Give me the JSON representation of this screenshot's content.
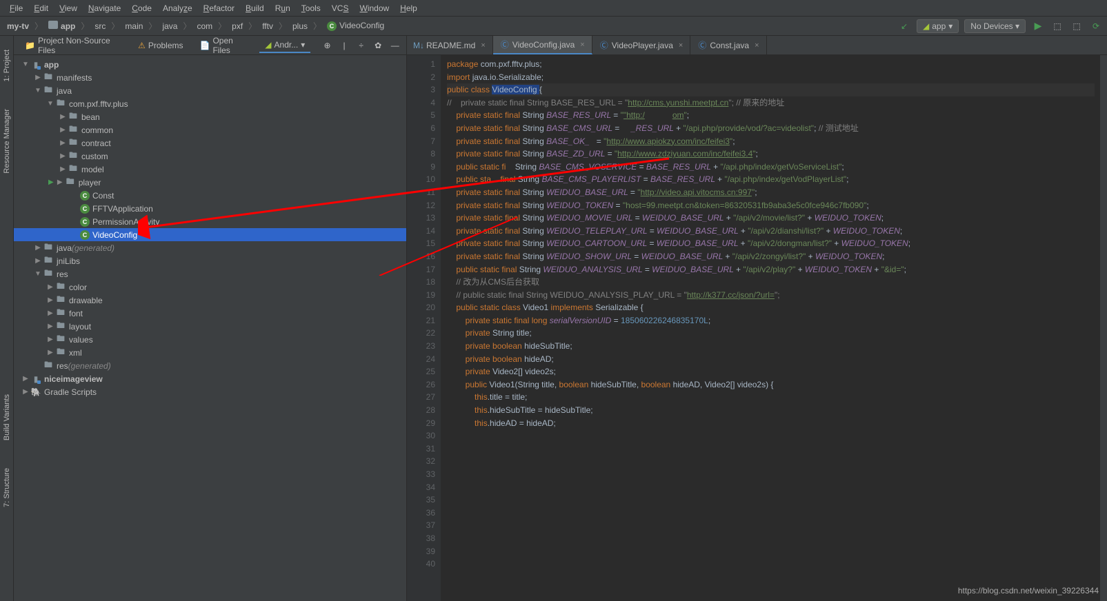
{
  "menu": {
    "file": "File",
    "edit": "Edit",
    "view": "View",
    "navigate": "Navigate",
    "code": "Code",
    "analyze": "Analyze",
    "refactor": "Refactor",
    "build": "Build",
    "run": "Run",
    "tools": "Tools",
    "vcs": "VCS",
    "window": "Window",
    "help": "Help"
  },
  "breadcrumb": [
    "my-tv",
    "app",
    "src",
    "main",
    "java",
    "com",
    "pxf",
    "fftv",
    "plus",
    "VideoConfig"
  ],
  "nav_right": {
    "run_config": "app",
    "devices": "No Devices ▾"
  },
  "panel_tabs": {
    "nsf": "Project Non-Source Files",
    "problems": "Problems",
    "open_files": "Open Files",
    "android": "Andr..."
  },
  "left_tabs": {
    "project": "1: Project",
    "rm": "Resource Manager",
    "bv": "Build Variants",
    "struct": "7: Structure"
  },
  "tree": {
    "app": "app",
    "manifests": "manifests",
    "java": "java",
    "pkg": "com.pxf.fftv.plus",
    "bean": "bean",
    "common": "common",
    "contract": "contract",
    "custom": "custom",
    "model": "model",
    "player": "player",
    "const": "Const",
    "fftvapp": "FFTVApplication",
    "permact": "PermissionActivity",
    "videoconfig": "VideoConfig",
    "javagen": "java",
    "gen": " (generated)",
    "jnilibs": "jniLibs",
    "res": "res",
    "color": "color",
    "drawable": "drawable",
    "font": "font",
    "layout": "layout",
    "values": "values",
    "xml": "xml",
    "resgen": "res",
    "niceimageview": "niceimageview",
    "gradle": "Gradle Scripts"
  },
  "editor_tabs": [
    {
      "name": "README.md",
      "icon": "md",
      "active": false
    },
    {
      "name": "VideoConfig.java",
      "icon": "java",
      "active": true
    },
    {
      "name": "VideoPlayer.java",
      "icon": "java",
      "active": false
    },
    {
      "name": "Const.java",
      "icon": "java",
      "active": false
    }
  ],
  "code": {
    "lines": [
      1,
      2,
      3,
      4,
      5,
      6,
      7,
      8,
      9,
      10,
      11,
      12,
      13,
      14,
      15,
      16,
      17,
      18,
      19,
      20,
      21,
      22,
      23,
      24,
      25,
      26,
      27,
      28,
      29,
      30,
      31,
      32,
      33,
      34,
      35,
      36,
      37,
      38,
      39,
      40
    ],
    "l1_a": "package ",
    "l1_b": "com.pxf.fftv.plus;",
    "l3_a": "import ",
    "l3_b": "java.io.Serializable;",
    "l5_a": "public class ",
    "l5_b": "VideoConfig ",
    "l5_c": "{",
    "l6": "//    private static final String BASE_RES_URL = \"",
    "l6b": "http://cms.yunshi.meetpt.cn",
    "l6c": "\"; // 原来的地址",
    "l7_a": "private static final ",
    "l7_b": "String ",
    "l7_c": "BASE_RES_URL ",
    "l7_d": "= ",
    "l7_e": "\"http:/",
    "l7_f": "om\"",
    "l7_g": ";",
    "l9_a": "private static final ",
    "l9_b": "String ",
    "l9_c": "BASE_CMS_URL ",
    "l9_d": "= ",
    "l9_e": "_RES_URL ",
    "l9_f": "+ ",
    "l9_g": "\"/api.php/provide/vod/?ac=videolist\"",
    "l9_h": "; ",
    "l9_i": "// 测试地址",
    "l10_a": "private static final ",
    "l10_b": "String ",
    "l10_c": "BASE_OK_",
    "l10_d": "= ",
    "l10_e": "\"http://www.apiokzy.com/inc/feifei3\"",
    "l10_f": ";",
    "l11_a": "private static final ",
    "l11_b": "String ",
    "l11_c": "BASE_ZD_URL ",
    "l11_d": "= ",
    "l11_e": "\"http://www.zdziyuan.com/inc/feifei3.4\"",
    "l11_f": ";",
    "l13_a": "public static fi",
    "l13_b": " String ",
    "l13_c": "BASE_CMS_VOSERVICE ",
    "l13_d": "= ",
    "l13_e": "BASE_RES_URL ",
    "l13_f": "+ ",
    "l13_g": "\"/api.php/index/getVoServiceList\"",
    "l13_h": ";",
    "l14_a": "public sta",
    "l14_b": " final ",
    "l14_b2": "String ",
    "l14_c": "BASE_CMS_PLAYERLIST ",
    "l14_d": "= ",
    "l14_e": "BASE_RES_URL ",
    "l14_f": "+ ",
    "l14_g": "\"/api.php/index/getVodPlayerList\"",
    "l14_h": ";",
    "l15_a": "private",
    "l15_b": " static final ",
    "l15_b2": "String ",
    "l15_c": "WEIDUO_BASE_URL ",
    "l15_d": "= ",
    "l15_e": "\"http://video.api.vitocms.cn:997\"",
    "l15_f": ";",
    "l16_a": "private static final ",
    "l16_b": "String ",
    "l16_c": "WEIDUO_TOKEN ",
    "l16_d": "= ",
    "l16_e": "\"host=99.meetpt.cn&token=86320531fb9aba3e5c0fce946c7fb090\"",
    "l16_f": ";",
    "l17_a": "private static final ",
    "l17_b": "String ",
    "l17_c": "WEIDUO_MOVIE_URL ",
    "l17_d": "= ",
    "l17_e": "WEIDUO_BASE_URL ",
    "l17_f": "+ ",
    "l17_g": "\"/api/v2/movie/list?\" ",
    "l17_h": "+ ",
    "l17_i": "WEIDUO_TOKEN",
    "l17_j": ";",
    "l18_a": "private static final ",
    "l18_b": "String ",
    "l18_c": "WEIDUO_TELEPLAY_URL ",
    "l18_d": "= ",
    "l18_e": "WEIDUO_BASE_URL ",
    "l18_f": "+ ",
    "l18_g": "\"/api/v2/dianshi/list?\" ",
    "l18_h": "+ ",
    "l18_i": "WEIDUO_TOKEN",
    "l18_j": ";",
    "l19_a": "private static final ",
    "l19_b": "String ",
    "l19_c": "WEIDUO_CARTOON_URL ",
    "l19_d": "= ",
    "l19_e": "WEIDUO_BASE_URL ",
    "l19_f": "+ ",
    "l19_g": "\"/api/v2/dongman/list?\" ",
    "l19_h": "+ ",
    "l19_i": "WEIDUO_TOKEN",
    "l19_j": ";",
    "l20_a": "private static final ",
    "l20_b": "String ",
    "l20_c": "WEIDUO_SHOW_URL ",
    "l20_d": "= ",
    "l20_e": "WEIDUO_BASE_URL ",
    "l20_f": "+ ",
    "l20_g": "\"/api/v2/zongyi/list?\" ",
    "l20_h": "+ ",
    "l20_i": "WEIDUO_TOKEN",
    "l20_j": ";",
    "l21_a": "public static final ",
    "l21_b": "String ",
    "l21_c": "WEIDUO_ANALYSIS_URL ",
    "l21_d": "= ",
    "l21_e": "WEIDUO_BASE_URL ",
    "l21_f": "+ ",
    "l21_g": "\"/api/v2/play?\" ",
    "l21_h": "+ ",
    "l21_i": "WEIDUO_TOKEN ",
    "l21_j": "+ ",
    "l21_k": "\"&id=\"",
    "l21_l": ";",
    "l22": "// 改为从CMS后台获取",
    "l23": "// public static final String WEIDUO_ANALYSIS_PLAY_URL = \"",
    "l23b": "http://k377.cc/json/?url=",
    "l23c": "\";",
    "l25_a": "public static class ",
    "l25_b": "Video1 ",
    "l25_c": "implements ",
    "l25_d": "Serializable ",
    "l25_e": "{",
    "l27_a": "private static final long ",
    "l27_b": "serialVersionUID ",
    "l27_c": "= ",
    "l27_d": "185060226246835170L",
    "l27_e": ";",
    "l29_a": "private ",
    "l29_b": "String ",
    "l29_c": "title;",
    "l31_a": "private boolean ",
    "l31_b": "hideSubTitle;",
    "l33_a": "private boolean ",
    "l33_b": "hideAD;",
    "l35_a": "private ",
    "l35_b": "Video2[] ",
    "l35_c": "video2s;",
    "l37_a": "public ",
    "l37_b": "Video1",
    "l37_c": "(String title, ",
    "l37_d": "boolean ",
    "l37_e": "hideSubTitle, ",
    "l37_f": "boolean ",
    "l37_g": "hideAD, Video2[] video2s) {",
    "l38_a": "this",
    "l38_b": ".title = title;",
    "l39_a": "this",
    "l39_b": ".hideSubTitle = hideSubTitle;",
    "l40_a": "this",
    "l40_b": ".hideAD = hideAD;"
  },
  "watermark": "https://blog.csdn.net/weixin_39226344"
}
